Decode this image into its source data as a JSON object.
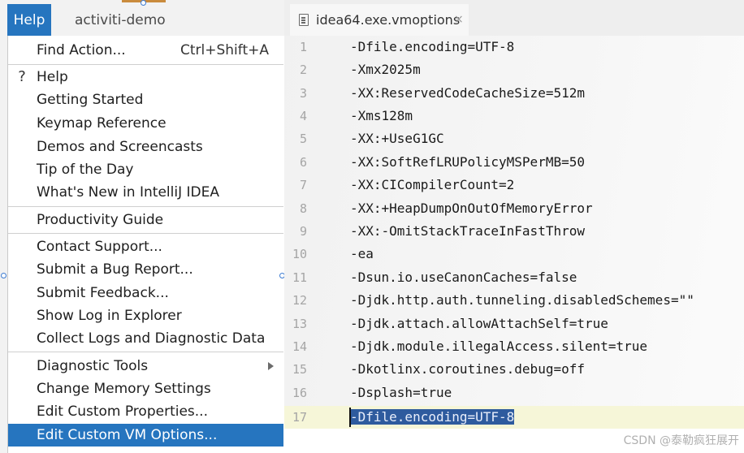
{
  "menubar": {
    "active_menu": "Help",
    "project_name": "activiti-demo"
  },
  "help_menu": {
    "items": [
      {
        "label": "Find Action...",
        "shortcut": "Ctrl+Shift+A"
      },
      {
        "label": "Help",
        "icon": "question-mark-icon"
      },
      {
        "label": "Getting Started"
      },
      {
        "label": "Keymap Reference"
      },
      {
        "label": "Demos and Screencasts"
      },
      {
        "label": "Tip of the Day"
      },
      {
        "label": "What's New in IntelliJ IDEA"
      },
      {
        "label": "Productivity Guide"
      },
      {
        "label": "Contact Support..."
      },
      {
        "label": "Submit a Bug Report..."
      },
      {
        "label": "Submit Feedback..."
      },
      {
        "label": "Show Log in Explorer"
      },
      {
        "label": "Collect Logs and Diagnostic Data"
      },
      {
        "label": "Diagnostic Tools",
        "icon": "submenu-arrow-icon"
      },
      {
        "label": "Change Memory Settings"
      },
      {
        "label": "Edit Custom Properties..."
      },
      {
        "label": "Edit Custom VM Options...",
        "selected": true
      }
    ],
    "question_glyph": "?"
  },
  "editor": {
    "tab_name": "idea64.exe.vmoptions",
    "close_glyph": "×",
    "lines": [
      {
        "no": "1",
        "text": "-Dfile.encoding=UTF-8"
      },
      {
        "no": "2",
        "text": "-Xmx2025m"
      },
      {
        "no": "3",
        "text": "-XX:ReservedCodeCacheSize=512m"
      },
      {
        "no": "4",
        "text": "-Xms128m"
      },
      {
        "no": "5",
        "text": "-XX:+UseG1GC"
      },
      {
        "no": "6",
        "text": "-XX:SoftRefLRUPolicyMSPerMB=50"
      },
      {
        "no": "7",
        "text": "-XX:CICompilerCount=2"
      },
      {
        "no": "8",
        "text": "-XX:+HeapDumpOnOutOfMemoryError"
      },
      {
        "no": "9",
        "text": "-XX:-OmitStackTraceInFastThrow"
      },
      {
        "no": "10",
        "text": "-ea"
      },
      {
        "no": "11",
        "text": "-Dsun.io.useCanonCaches=false"
      },
      {
        "no": "12",
        "text": "-Djdk.http.auth.tunneling.disabledSchemes=\"\""
      },
      {
        "no": "13",
        "text": "-Djdk.attach.allowAttachSelf=true"
      },
      {
        "no": "14",
        "text": "-Djdk.module.illegalAccess.silent=true"
      },
      {
        "no": "15",
        "text": "-Dkotlinx.coroutines.debug=off"
      },
      {
        "no": "16",
        "text": "-Dsplash=true"
      },
      {
        "no": "17",
        "text": "-Dfile.encoding=UTF-8",
        "selected": true
      }
    ]
  },
  "watermark": "CSDN @泰勒疯狂展开",
  "colors": {
    "selection_blue": "#2675bf",
    "text_selection": "#2e5b9e",
    "current_line": "#f6f6d8"
  }
}
